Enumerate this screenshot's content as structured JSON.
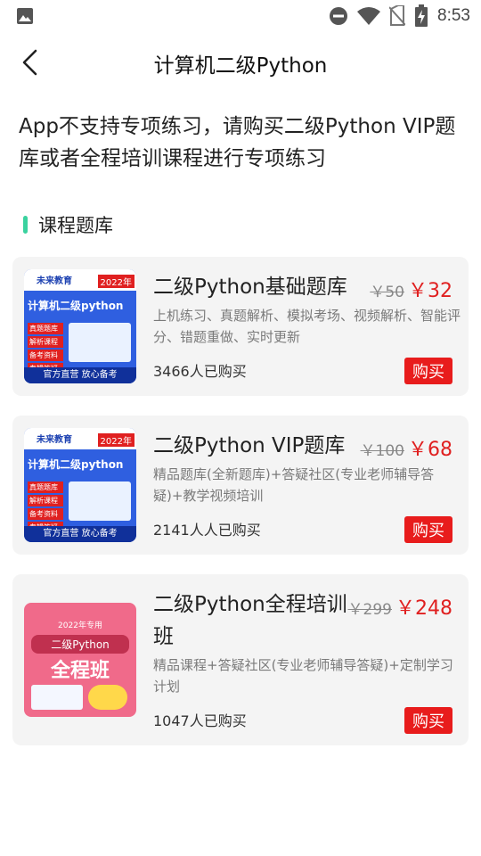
{
  "status_bar": {
    "time": "8:53",
    "icons": [
      "image-icon",
      "dnd-icon",
      "wifi-icon",
      "no-sim-icon",
      "battery-charging-icon"
    ]
  },
  "header": {
    "back_icon": "chevron-left-icon",
    "title": "计算机二级Python"
  },
  "notice": "App不支持专项练习，请购买二级Python VIP题库或者全程培训课程进行专项练习",
  "section": {
    "title": "课程题库",
    "accent_color": "#3ad29f"
  },
  "products": [
    {
      "title": "二级Python基础题库",
      "old_price": "￥50",
      "price": "￥32",
      "description": "上机练习、真题解析、模拟考场、视频解析、智能评分、错题重做、实时更新",
      "buyers": "3466人已购买",
      "buy_label": "购买",
      "thumb": {
        "brand": "未来教育",
        "year": "2022年",
        "headline": "计算机二级python",
        "tags": [
          "真题题库",
          "解析课程",
          "备考资料",
          "专辑答疑"
        ],
        "slogan": "官方直营 放心备考"
      }
    },
    {
      "title": "二级Python VIP题库",
      "old_price": "￥100",
      "price": "￥68",
      "description": "精品题库(全新题库)+答疑社区(专业老师辅导答疑)+教学视频培训",
      "buyers": "2141人人已购买",
      "buy_label": "购买",
      "thumb": {
        "brand": "未来教育",
        "year": "2022年",
        "headline": "计算机二级python",
        "tags": [
          "真题题库",
          "解析课程",
          "备考资料",
          "专辑答疑"
        ],
        "slogan": "官方直营 放心备考"
      }
    },
    {
      "title": "二级Python全程培训班",
      "old_price": "￥299",
      "price": "￥248",
      "description": "精品课程+答疑社区(专业老师辅导答疑)+定制学习计划",
      "buyers": "1047人已购买",
      "buy_label": "购买",
      "thumb": {
        "top": "2022年专用",
        "headline": "二级Python",
        "big": "全程班"
      }
    }
  ],
  "colors": {
    "price_red": "#e02020",
    "buy_red": "#e81c1c",
    "thumb_blue": "#2f5fe0",
    "thumb_pink": "#f06a8a"
  }
}
